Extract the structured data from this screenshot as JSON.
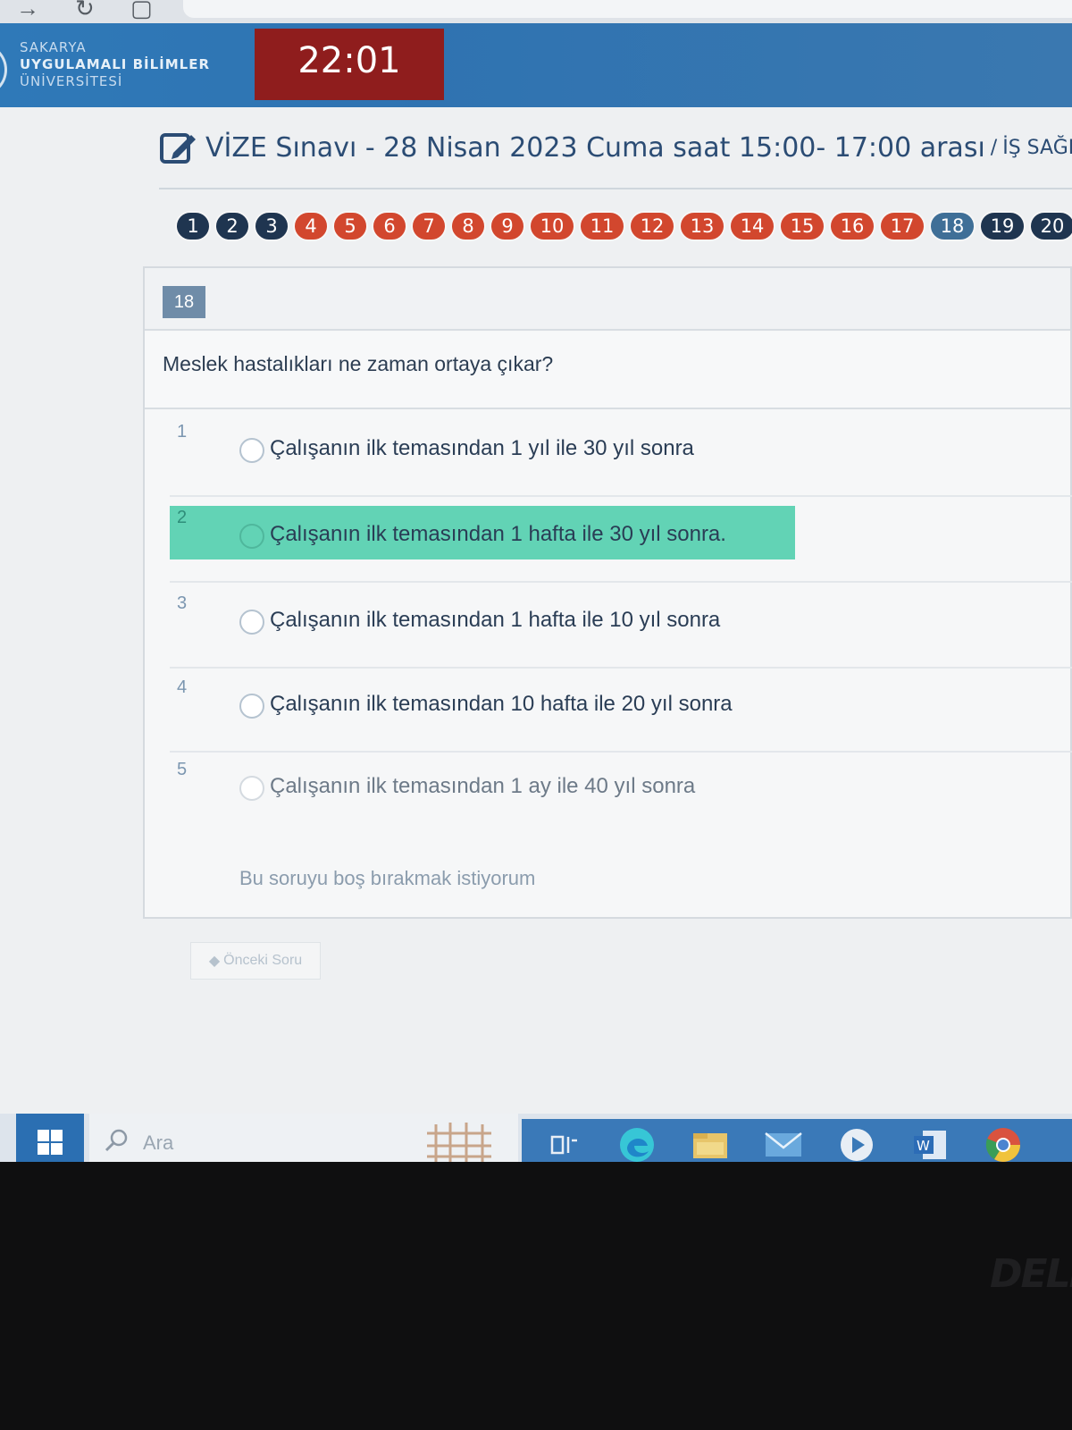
{
  "header": {
    "logo_lines": [
      "SAKARYA",
      "UYGULAMALI BİLİMLER",
      "ÜNİVERSİTESİ"
    ],
    "timer": "22:01"
  },
  "exam": {
    "title": "VİZE Sınavı - 28 Nisan 2023 Cuma saat 15:00- 17:00 arası",
    "separator": "/",
    "course": "İŞ SAĞLIĞ"
  },
  "question_nav": [
    {
      "label": "1",
      "status": "unanswered"
    },
    {
      "label": "2",
      "status": "unanswered"
    },
    {
      "label": "3",
      "status": "unanswered"
    },
    {
      "label": "4",
      "status": "answered"
    },
    {
      "label": "5",
      "status": "answered"
    },
    {
      "label": "6",
      "status": "answered"
    },
    {
      "label": "7",
      "status": "answered"
    },
    {
      "label": "8",
      "status": "answered"
    },
    {
      "label": "9",
      "status": "answered"
    },
    {
      "label": "10",
      "status": "answered"
    },
    {
      "label": "11",
      "status": "answered"
    },
    {
      "label": "12",
      "status": "answered"
    },
    {
      "label": "13",
      "status": "answered"
    },
    {
      "label": "14",
      "status": "answered"
    },
    {
      "label": "15",
      "status": "answered"
    },
    {
      "label": "16",
      "status": "answered"
    },
    {
      "label": "17",
      "status": "answered"
    },
    {
      "label": "18",
      "status": "current"
    },
    {
      "label": "19",
      "status": "unanswered"
    },
    {
      "label": "20",
      "status": "unanswered"
    }
  ],
  "question": {
    "number": "18",
    "text": "Meslek hastalıkları ne zaman ortaya çıkar?",
    "options": [
      {
        "num": "1",
        "text": "Çalışanın ilk temasından 1 yıl ile 30 yıl sonra",
        "selected": false
      },
      {
        "num": "2",
        "text": "Çalışanın ilk temasından 1 hafta ile 30 yıl sonra.",
        "selected": true
      },
      {
        "num": "3",
        "text": "Çalışanın ilk temasından 1 hafta ile 10 yıl sonra",
        "selected": false
      },
      {
        "num": "4",
        "text": "Çalışanın ilk temasından 10 hafta ile 20 yıl sonra",
        "selected": false
      },
      {
        "num": "5",
        "text": "Çalışanın ilk temasından 1 ay ile 40 yıl sonra",
        "selected": false
      }
    ],
    "skip_label": "Bu soruyu boş bırakmak istiyorum",
    "prev_label": "Önceki Soru"
  },
  "taskbar": {
    "search_label": "Ara",
    "icons": [
      "task-view-icon",
      "edge-icon",
      "file-explorer-icon",
      "mail-icon",
      "media-player-icon",
      "word-icon",
      "chrome-icon"
    ]
  },
  "bezel": {
    "brand": "DELL"
  },
  "colors": {
    "header_blue": "#2f79b8",
    "timer_red": "#8f1d1d",
    "answered_red": "#d2472e",
    "unanswered_navy": "#1f3550",
    "current_blue": "#3f6f97",
    "selected_green": "#62d3b5"
  }
}
